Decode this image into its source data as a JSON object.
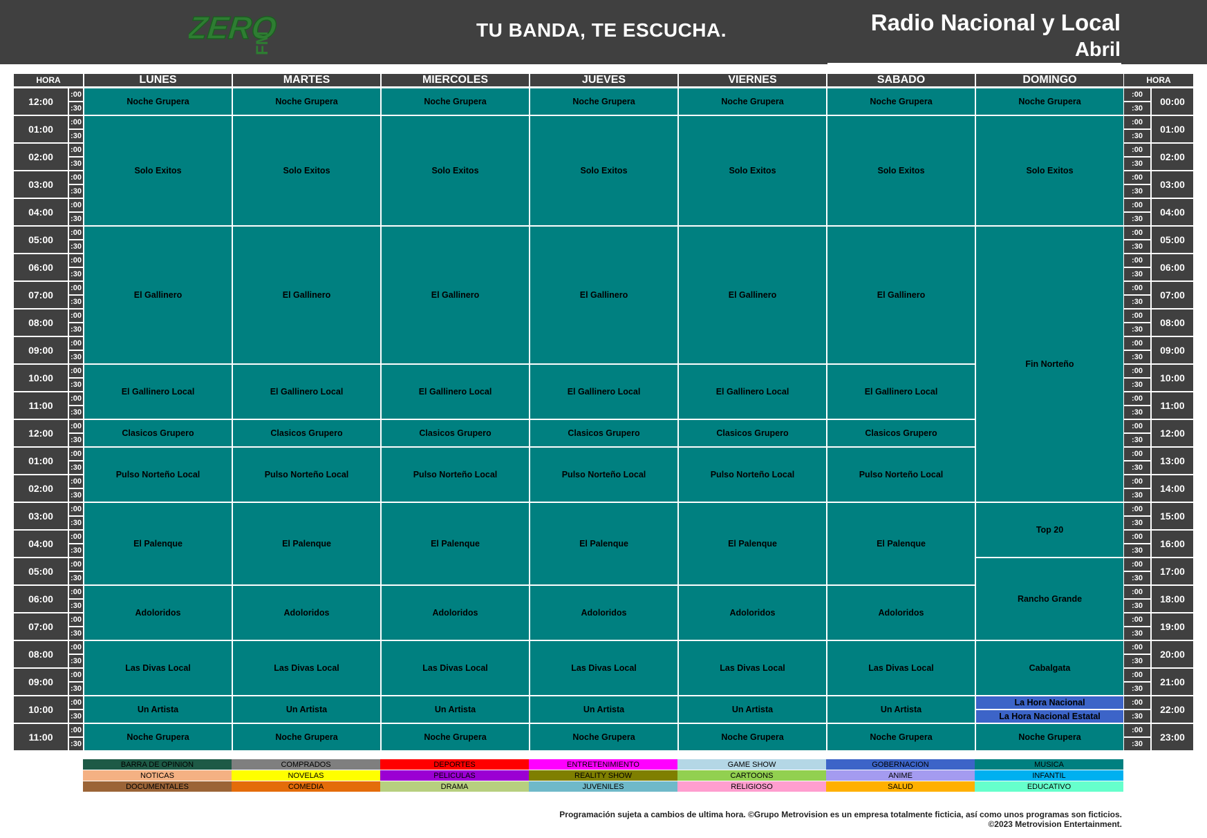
{
  "header": {
    "logo_text": "ZERO FM",
    "tagline": "TU BANDA, TE ESCUCHA.",
    "title": "Radio Nacional y Local",
    "month": "Abril"
  },
  "colors": {
    "header_bg": "#404040",
    "program_bg": "#008080",
    "highlight_bg": "#3c64c8",
    "logo_green": "#2e7d32"
  },
  "columns": {
    "left_hora": "HORA",
    "right_hora": "HORA",
    "days": [
      "LUNES",
      "MARTES",
      "MIERCOLES",
      "JUEVES",
      "VIERNES",
      "SABADO",
      "DOMINGO"
    ]
  },
  "left_hours": [
    "12:00",
    "01:00",
    "02:00",
    "03:00",
    "04:00",
    "05:00",
    "06:00",
    "07:00",
    "08:00",
    "09:00",
    "10:00",
    "11:00",
    "12:00",
    "01:00",
    "02:00",
    "03:00",
    "04:00",
    "05:00",
    "06:00",
    "07:00",
    "08:00",
    "09:00",
    "10:00",
    "11:00"
  ],
  "right_hours": [
    "00:00",
    "01:00",
    "02:00",
    "03:00",
    "04:00",
    "05:00",
    "06:00",
    "07:00",
    "08:00",
    "09:00",
    "10:00",
    "11:00",
    "12:00",
    "13:00",
    "14:00",
    "15:00",
    "16:00",
    "17:00",
    "18:00",
    "19:00",
    "20:00",
    "21:00",
    "22:00",
    "23:00"
  ],
  "minutes": [
    ":00",
    ":30"
  ],
  "weekday_programs": [
    {
      "name": "Noche Grupera",
      "start": 0,
      "end": 2
    },
    {
      "name": "Solo Exitos",
      "start": 2,
      "end": 10
    },
    {
      "name": "El Gallinero",
      "start": 10,
      "end": 20
    },
    {
      "name": "El Gallinero Local",
      "start": 20,
      "end": 24
    },
    {
      "name": "Clasicos Grupero",
      "start": 24,
      "end": 26
    },
    {
      "name": "Pulso Norteño Local",
      "start": 26,
      "end": 30
    },
    {
      "name": "El Palenque",
      "start": 30,
      "end": 36
    },
    {
      "name": "Adoloridos",
      "start": 36,
      "end": 40
    },
    {
      "name": "Las Divas Local",
      "start": 40,
      "end": 44
    },
    {
      "name": "Un Artista",
      "start": 44,
      "end": 46
    },
    {
      "name": "Noche Grupera",
      "start": 46,
      "end": 48
    }
  ],
  "sunday_programs": [
    {
      "name": "Noche Grupera",
      "start": 0,
      "end": 2,
      "style": "normal"
    },
    {
      "name": "Solo Exitos",
      "start": 2,
      "end": 10,
      "style": "normal"
    },
    {
      "name": "Fin Norteño",
      "start": 10,
      "end": 30,
      "style": "normal"
    },
    {
      "name": "Top 20",
      "start": 30,
      "end": 34,
      "style": "normal"
    },
    {
      "name": "Rancho Grande",
      "start": 34,
      "end": 40,
      "style": "normal"
    },
    {
      "name": "Cabalgata",
      "start": 40,
      "end": 44,
      "style": "normal"
    },
    {
      "name": "La Hora Nacional",
      "start": 44,
      "end": 45,
      "style": "blue"
    },
    {
      "name": "La Hora Nacional Estatal",
      "start": 45,
      "end": 46,
      "style": "blue"
    },
    {
      "name": "Noche Grupera",
      "start": 46,
      "end": 48,
      "style": "normal"
    }
  ],
  "legend": [
    [
      {
        "label": "BARRA DE OPINION",
        "color": "#1e5a46"
      },
      {
        "label": "COMPRADOS",
        "color": "#7f7f7f"
      },
      {
        "label": "DEPORTES",
        "color": "#ff0000"
      },
      {
        "label": "ENTRETENIMIENTO",
        "color": "#ff00ff"
      },
      {
        "label": "GAME SHOW",
        "color": "#b4d7e6"
      },
      {
        "label": "GOBERNACION",
        "color": "#3c64c8"
      },
      {
        "label": "MUSICA",
        "color": "#008080"
      }
    ],
    [
      {
        "label": "NOTICAS",
        "color": "#f4b183"
      },
      {
        "label": "NOVELAS",
        "color": "#ffff00"
      },
      {
        "label": "PELICULAS",
        "color": "#9b00d3"
      },
      {
        "label": "REALITY SHOW",
        "color": "#7f7f00"
      },
      {
        "label": "CARTOONS",
        "color": "#92d050"
      },
      {
        "label": "ANIME",
        "color": "#a49bf0"
      },
      {
        "label": "INFANTIL",
        "color": "#00b0f0"
      }
    ],
    [
      {
        "label": "DOCUMENTALES",
        "color": "#9b6437"
      },
      {
        "label": "COMEDIA",
        "color": "#e46c0a"
      },
      {
        "label": "DRAMA",
        "color": "#b7cf7f"
      },
      {
        "label": "JUVENILES",
        "color": "#6fb9c9"
      },
      {
        "label": "RELIGIOSO",
        "color": "#ff9ecf"
      },
      {
        "label": "SALUD",
        "color": "#ffb000"
      },
      {
        "label": "EDUCATIVO",
        "color": "#66ffcc"
      }
    ]
  ],
  "footer": {
    "line1": "Programación sujeta a cambios de ultima hora. ©Grupo Metrovision es un empresa totalmente ficticia, así como unos programas son ficticios.",
    "line2": "©2023 Metrovision Entertainment."
  }
}
